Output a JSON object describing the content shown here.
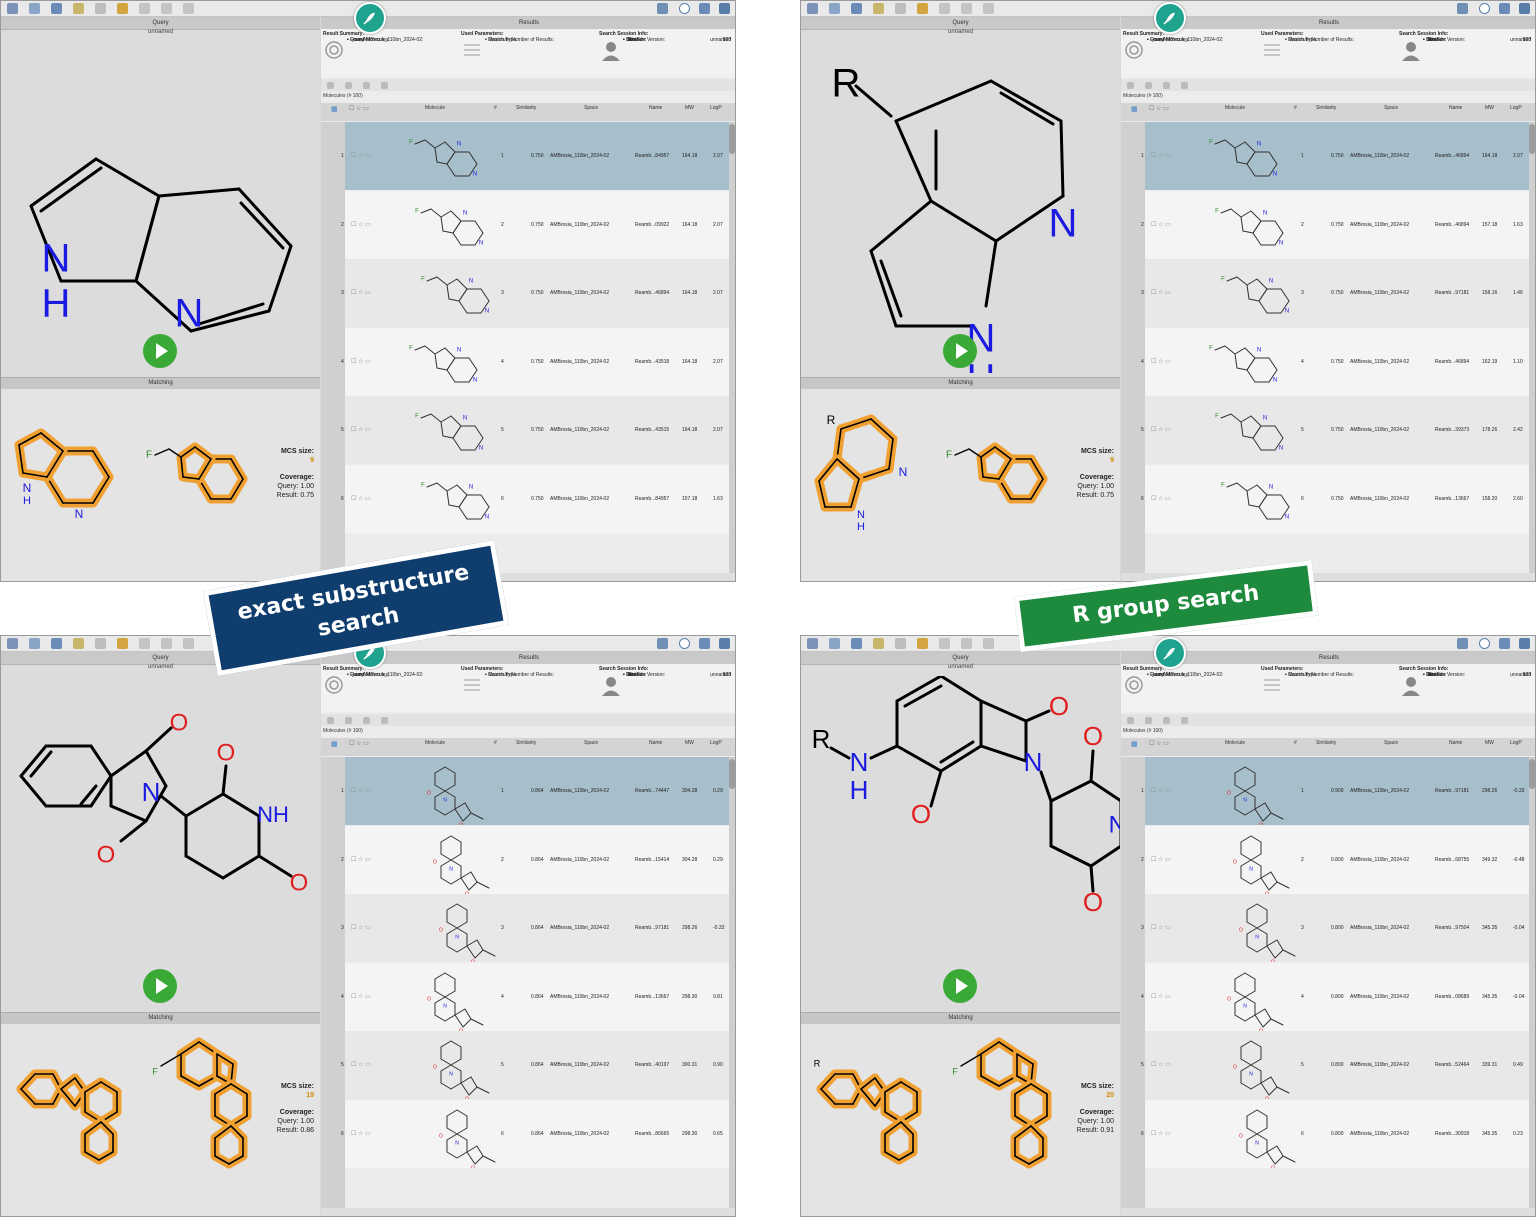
{
  "labels": {
    "query": "Query",
    "results": "Results",
    "matching": "Matching",
    "mcs_size": "MCS size:",
    "coverage": "Coverage:",
    "result_summary": "Result Summary:",
    "used_parameters": "Used Parameters:",
    "session_info": "Search Session Info:",
    "query_key": "• Query:",
    "found_key": "• Found Molecules:",
    "from_key": "• From AMBrosia_110bn_2024-02:",
    "search_type_key": "• Search Type:",
    "max_results_key": "• Maximum Number of Results:",
    "id_key": "• ID:",
    "user_key": "• User:",
    "started_key": "• Started:",
    "duration_key": "• Duration:",
    "version_key": "• InfiniSee Version:",
    "molecules_count": "Molecules (# 100)",
    "col_molecule": "Molecule",
    "col_num": "#",
    "col_similarity": "Similarity",
    "col_space": "Space",
    "col_name": "Name",
    "col_mw": "MW",
    "col_logp": "LogP"
  },
  "banners": {
    "exact": "exact substructure search",
    "rgroup": "R group search"
  },
  "colors": {
    "exact_banner": "#0f3e6e",
    "rgroup_banner": "#1e8a3e",
    "highlight_row": "#a7bfca",
    "match_orange": "#f0a030",
    "play_green": "#3aa935"
  },
  "panels": [
    {
      "query_name": "unnamed",
      "summary": {
        "query": "unnamed",
        "found": "100",
        "from": "100",
        "search_type": "Exact Substructure",
        "max_results": "100",
        "id": "1",
        "user": "Alexander Neumann",
        "started": "15:40 2024-06-24",
        "duration": "00:01:26",
        "version": "6.1.0"
      },
      "mcs_size": "9",
      "coverage_query": "Query: 1.00",
      "coverage_result": "Result: 0.75",
      "rows": [
        {
          "n": "1",
          "sim": "0.750",
          "space": "AMBrosia_110bn_2024-02",
          "name": "Reamb...84957",
          "mw": "164.18",
          "logp": "2.07"
        },
        {
          "n": "2",
          "sim": "0.750",
          "space": "AMBrosia_110bn_2024-02",
          "name": "Reamb...09922",
          "mw": "164.18",
          "logp": "2.07"
        },
        {
          "n": "3",
          "sim": "0.750",
          "space": "AMBrosia_110bn_2024-02",
          "name": "Reamb...46894",
          "mw": "164.18",
          "logp": "2.07"
        },
        {
          "n": "4",
          "sim": "0.750",
          "space": "AMBrosia_110bn_2024-02",
          "name": "Reamb...43518",
          "mw": "164.18",
          "logp": "2.07"
        },
        {
          "n": "5",
          "sim": "0.750",
          "space": "AMBrosia_110bn_2024-02",
          "name": "Reamb...43515",
          "mw": "164.18",
          "logp": "2.07"
        },
        {
          "n": "6",
          "sim": "0.750",
          "space": "AMBrosia_110bn_2024-02",
          "name": "Reamb...84957",
          "mw": "157.18",
          "logp": "1.63"
        }
      ]
    },
    {
      "query_name": "unnamed",
      "summary": {
        "query": "unnamed",
        "found": "100",
        "from": "100",
        "search_type": "R Group",
        "max_results": "100",
        "id": "2",
        "user": "Alexander Neumann",
        "started": "15:44 2024-06-24",
        "duration": "00:01:25",
        "version": "6.1.0"
      },
      "mcs_size": "9",
      "coverage_query": "Query: 1.00",
      "coverage_result": "Result: 0.75",
      "rows": [
        {
          "n": "1",
          "sim": "0.750",
          "space": "AMBrosia_110bn_2024-02",
          "name": "Reamb...46894",
          "mw": "164.18",
          "logp": "2.07"
        },
        {
          "n": "2",
          "sim": "0.750",
          "space": "AMBrosia_110bn_2024-02",
          "name": "Reamb...46894",
          "mw": "157.18",
          "logp": "1.63"
        },
        {
          "n": "3",
          "sim": "0.750",
          "space": "AMBrosia_110bn_2024-02",
          "name": "Reamb...97181",
          "mw": "158.16",
          "logp": "1.46"
        },
        {
          "n": "4",
          "sim": "0.750",
          "space": "AMBrosia_110bn_2024-02",
          "name": "Reamb...46894",
          "mw": "162.19",
          "logp": "1.10"
        },
        {
          "n": "5",
          "sim": "0.750",
          "space": "AMBrosia_110bn_2024-02",
          "name": "Reamb...39373",
          "mw": "178.26",
          "logp": "2.42"
        },
        {
          "n": "6",
          "sim": "0.750",
          "space": "AMBrosia_110bn_2024-02",
          "name": "Reamb...13667",
          "mw": "158.20",
          "logp": "2.60"
        }
      ]
    },
    {
      "query_name": "unnamed",
      "summary": {
        "query": "unnamed",
        "found": "100",
        "from": "100",
        "search_type": "Exact Substructure",
        "max_results": "100",
        "id": "3",
        "user": "Alexander Neumann",
        "started": "15:47 2024-06-24",
        "duration": "00:01:24",
        "version": "6.1.0"
      },
      "mcs_size": "19",
      "coverage_query": "Query: 1.00",
      "coverage_result": "Result: 0.86",
      "rows": [
        {
          "n": "1",
          "sim": "0.864",
          "space": "AMBrosia_110bn_2024-02",
          "name": "Reamb...74447",
          "mw": "304.28",
          "logp": "0.29"
        },
        {
          "n": "2",
          "sim": "0.864",
          "space": "AMBrosia_110bn_2024-02",
          "name": "Reamb...15414",
          "mw": "304.28",
          "logp": "0.29"
        },
        {
          "n": "3",
          "sim": "0.864",
          "space": "AMBrosia_110bn_2024-02",
          "name": "Reamb...97181",
          "mw": "298.26",
          "logp": "-0.33"
        },
        {
          "n": "4",
          "sim": "0.864",
          "space": "AMBrosia_110bn_2024-02",
          "name": "Reamb...13667",
          "mw": "298.30",
          "logp": "0.81"
        },
        {
          "n": "5",
          "sim": "0.864",
          "space": "AMBrosia_110bn_2024-02",
          "name": "Reamb...40197",
          "mw": "300.31",
          "logp": "0.90"
        },
        {
          "n": "6",
          "sim": "0.864",
          "space": "AMBrosia_110bn_2024-02",
          "name": "Reamb...86665",
          "mw": "298.30",
          "logp": "0.65"
        }
      ]
    },
    {
      "query_name": "unnamed",
      "summary": {
        "query": "unnamed",
        "found": "100",
        "from": "100",
        "search_type": "R Group",
        "max_results": "100",
        "id": "4",
        "user": "Alexander Neumann",
        "started": "15:50 2024-06-24",
        "duration": "00:01:24",
        "version": "6.1.0"
      },
      "mcs_size": "20",
      "coverage_query": "Query: 1.00",
      "coverage_result": "Result: 0.91",
      "rows": [
        {
          "n": "1",
          "sim": "0.909",
          "space": "AMBrosia_110bn_2024-02",
          "name": "Reamb...97181",
          "mw": "298.26",
          "logp": "-0.33"
        },
        {
          "n": "2",
          "sim": "0.800",
          "space": "AMBrosia_110bn_2024-02",
          "name": "Reamb...68755",
          "mw": "349.32",
          "logp": "-0.48"
        },
        {
          "n": "3",
          "sim": "0.800",
          "space": "AMBrosia_110bn_2024-02",
          "name": "Reamb...97504",
          "mw": "345.35",
          "logp": "-0.04"
        },
        {
          "n": "4",
          "sim": "0.800",
          "space": "AMBrosia_110bn_2024-02",
          "name": "Reamb...08689",
          "mw": "345.35",
          "logp": "-0.04"
        },
        {
          "n": "5",
          "sim": "0.800",
          "space": "AMBrosia_110bn_2024-02",
          "name": "Reamb...52464",
          "mw": "339.31",
          "logp": "0.49"
        },
        {
          "n": "6",
          "sim": "0.800",
          "space": "AMBrosia_110bn_2024-02",
          "name": "Reamb...30918",
          "mw": "345.35",
          "logp": "0.23"
        }
      ]
    }
  ]
}
